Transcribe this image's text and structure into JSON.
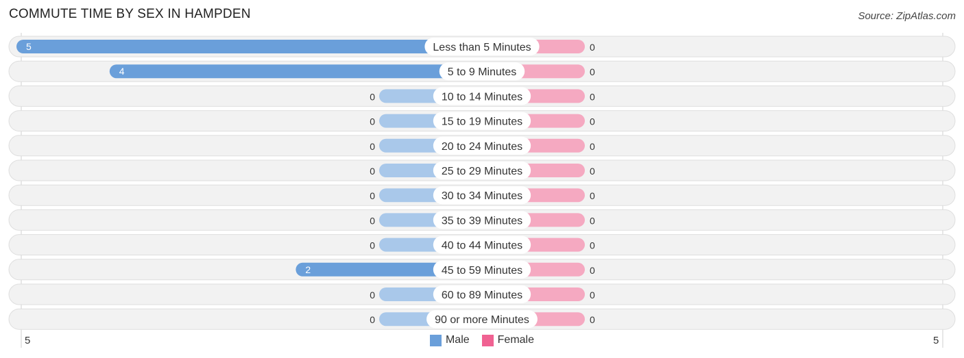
{
  "header": {
    "title": "COMMUTE TIME BY SEX IN HAMPDEN",
    "source": "Source: ZipAtlas.com"
  },
  "colors": {
    "male": "#6a9fda",
    "male_light": "#a9c8ea",
    "female": "#f06292",
    "female_light": "#f5a9c1",
    "row_bg": "#f2f2f2"
  },
  "chart_data": {
    "type": "bar",
    "orientation": "horizontal-diverging",
    "title": "COMMUTE TIME BY SEX IN HAMPDEN",
    "categories": [
      "Less than 5 Minutes",
      "5 to 9 Minutes",
      "10 to 14 Minutes",
      "15 to 19 Minutes",
      "20 to 24 Minutes",
      "25 to 29 Minutes",
      "30 to 34 Minutes",
      "35 to 39 Minutes",
      "40 to 44 Minutes",
      "45 to 59 Minutes",
      "60 to 89 Minutes",
      "90 or more Minutes"
    ],
    "series": [
      {
        "name": "Male",
        "values": [
          5,
          4,
          0,
          0,
          0,
          0,
          0,
          0,
          0,
          2,
          0,
          0
        ]
      },
      {
        "name": "Female",
        "values": [
          0,
          0,
          0,
          0,
          0,
          0,
          0,
          0,
          0,
          0,
          0,
          0
        ]
      }
    ],
    "axis": {
      "left_label": "5",
      "right_label": "5",
      "max": 5
    },
    "legend": {
      "position": "bottom-center",
      "entries": [
        "Male",
        "Female"
      ]
    }
  }
}
